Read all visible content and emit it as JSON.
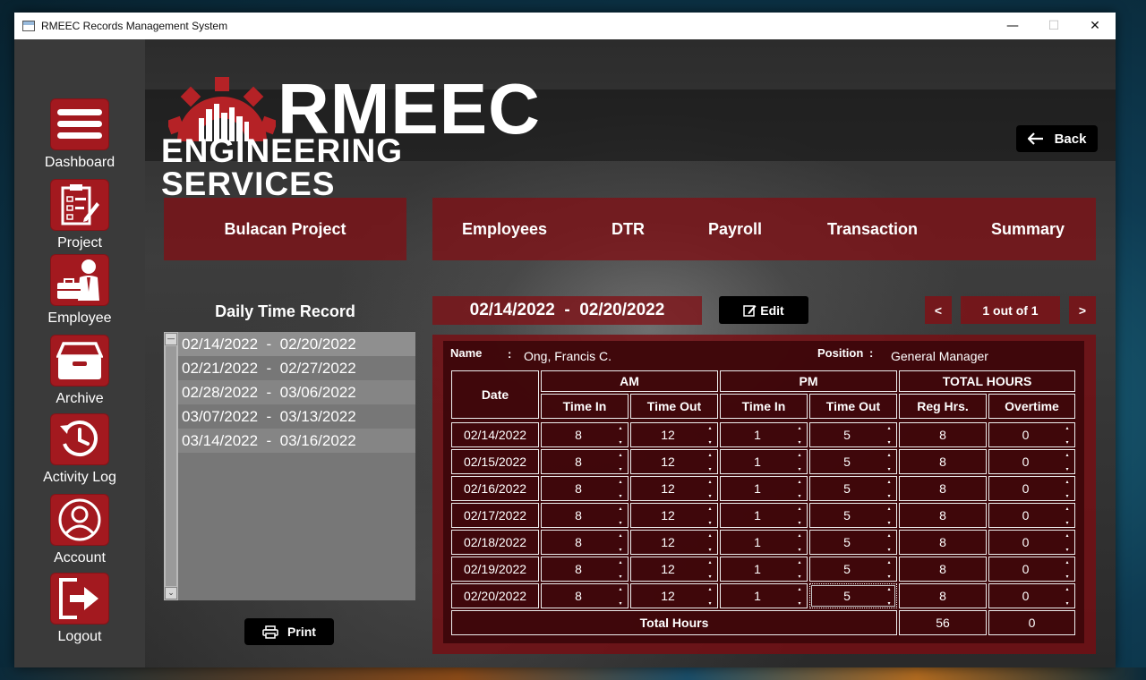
{
  "window": {
    "title": "RMEEC Records Management System",
    "min": "—",
    "max": "☐",
    "close": "✕"
  },
  "sidebar": {
    "items": [
      {
        "label": "Dashboard",
        "icon": "menu-icon"
      },
      {
        "label": "Project",
        "icon": "clipboard-icon"
      },
      {
        "label": "Employee",
        "icon": "employee-icon"
      },
      {
        "label": "Archive",
        "icon": "archive-box-icon"
      },
      {
        "label": "Activity Log",
        "icon": "history-clock-icon"
      },
      {
        "label": "Account",
        "icon": "user-circle-icon"
      },
      {
        "label": "Logout",
        "icon": "logout-icon"
      }
    ]
  },
  "logo": {
    "line1": "RMEEC",
    "line2": "ENGINEERING SERVICES"
  },
  "header": {
    "back_label": "Back"
  },
  "project": {
    "name": "Bulacan Project"
  },
  "tabs": [
    "Employees",
    "DTR",
    "Payroll",
    "Transaction",
    "Summary"
  ],
  "dtr": {
    "title": "Daily Time Record",
    "periods": [
      "02/14/2022  -  02/20/2022",
      "02/21/2022  -  02/27/2022",
      "02/28/2022  -  03/06/2022",
      "03/07/2022  -  03/13/2022",
      "03/14/2022  -  03/16/2022"
    ],
    "print_label": "Print"
  },
  "record": {
    "range": "02/14/2022  -  02/20/2022",
    "edit_label": "Edit",
    "pager": {
      "prev": "<",
      "next": ">",
      "text": "1 out of 1"
    },
    "name_label": "Name",
    "name_sep": ":",
    "name_value": "Ong, Francis C.",
    "position_label": "Position",
    "position_sep": ":",
    "position_value": "General Manager"
  },
  "table": {
    "group_headers": {
      "date": "Date",
      "am": "AM",
      "pm": "PM",
      "total": "TOTAL HOURS"
    },
    "sub_headers": [
      "Time In",
      "Time Out",
      "Time In",
      "Time Out",
      "Reg Hrs.",
      "Overtime"
    ],
    "rows": [
      {
        "date": "02/14/2022",
        "am_in": "8",
        "am_out": "12",
        "pm_in": "1",
        "pm_out": "5",
        "reg": "8",
        "ot": "0"
      },
      {
        "date": "02/15/2022",
        "am_in": "8",
        "am_out": "12",
        "pm_in": "1",
        "pm_out": "5",
        "reg": "8",
        "ot": "0"
      },
      {
        "date": "02/16/2022",
        "am_in": "8",
        "am_out": "12",
        "pm_in": "1",
        "pm_out": "5",
        "reg": "8",
        "ot": "0"
      },
      {
        "date": "02/17/2022",
        "am_in": "8",
        "am_out": "12",
        "pm_in": "1",
        "pm_out": "5",
        "reg": "8",
        "ot": "0"
      },
      {
        "date": "02/18/2022",
        "am_in": "8",
        "am_out": "12",
        "pm_in": "1",
        "pm_out": "5",
        "reg": "8",
        "ot": "0"
      },
      {
        "date": "02/19/2022",
        "am_in": "8",
        "am_out": "12",
        "pm_in": "1",
        "pm_out": "5",
        "reg": "8",
        "ot": "0"
      },
      {
        "date": "02/20/2022",
        "am_in": "8",
        "am_out": "12",
        "pm_in": "1",
        "pm_out": "5",
        "reg": "8",
        "ot": "0"
      }
    ],
    "total_label": "Total Hours",
    "total_reg": "56",
    "total_ot": "0"
  },
  "colors": {
    "accent_red": "#a3191f",
    "panel_red": "#820f14"
  }
}
